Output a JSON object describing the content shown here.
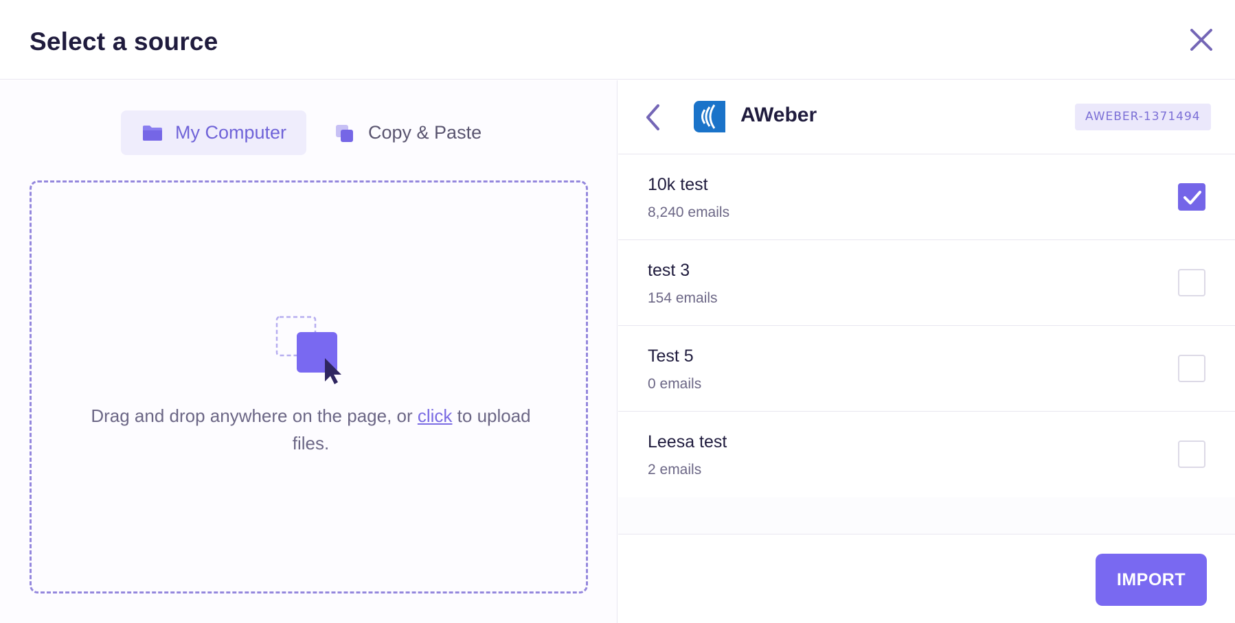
{
  "dialog": {
    "title": "Select a source"
  },
  "tabs": [
    {
      "label": "My Computer",
      "icon": "folder-icon",
      "active": true
    },
    {
      "label": "Copy & Paste",
      "icon": "copy-icon",
      "active": false
    }
  ],
  "dropzone": {
    "text_before": "Drag and drop anywhere on the page, or ",
    "link": "click",
    "text_after": " to upload files."
  },
  "source": {
    "name": "AWeber",
    "account_id": "AWEBER-1371494"
  },
  "lists": [
    {
      "name": "10k test",
      "count": "8,240 emails",
      "checked": true
    },
    {
      "name": "test 3",
      "count": "154 emails",
      "checked": false
    },
    {
      "name": "Test 5",
      "count": "0 emails",
      "checked": false
    },
    {
      "name": "Leesa test",
      "count": "2 emails",
      "checked": false
    }
  ],
  "actions": {
    "import_label": "IMPORT"
  },
  "colors": {
    "accent": "#7969f1",
    "accent_light": "#efedfc",
    "text_dark": "#1f1b3d",
    "text_muted": "#6b6685",
    "aweber_blue": "#1a73c9"
  }
}
